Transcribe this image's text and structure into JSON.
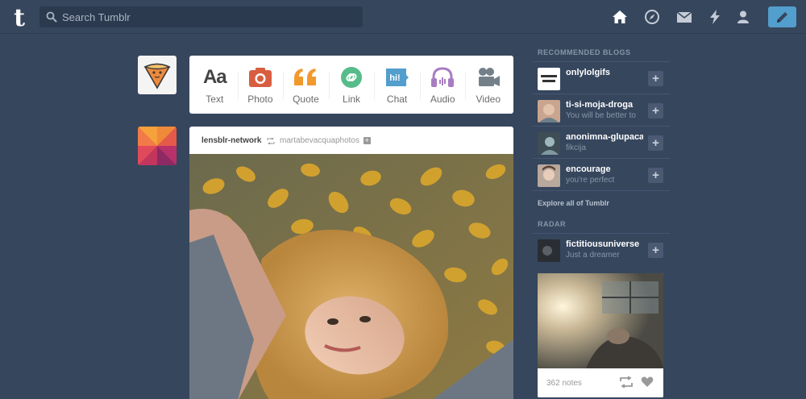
{
  "header": {
    "logo_letter": "t",
    "search_placeholder": "Search Tumblr",
    "nav_icons": [
      "home-icon",
      "explore-compass-icon",
      "inbox-mail-icon",
      "activity-lightning-icon",
      "account-person-icon",
      "compose-pencil-icon"
    ]
  },
  "post_types": [
    {
      "label": "Text",
      "icon": "text-icon",
      "color": "#444444"
    },
    {
      "label": "Photo",
      "icon": "camera-icon",
      "color": "#d95e40"
    },
    {
      "label": "Quote",
      "icon": "quote-icon",
      "color": "#f2992e"
    },
    {
      "label": "Link",
      "icon": "link-icon",
      "color": "#56bc8a"
    },
    {
      "label": "Chat",
      "icon": "chat-icon",
      "color": "#529ecc"
    },
    {
      "label": "Audio",
      "icon": "headphones-icon",
      "color": "#a77dc2"
    },
    {
      "label": "Video",
      "icon": "video-camera-icon",
      "color": "#748089"
    }
  ],
  "post": {
    "blog": "lensblr-network",
    "reblogged_from": "martabevacquaphotos"
  },
  "sidebar": {
    "recommended_heading": "Recommended Blogs",
    "recommended": [
      {
        "name": "onlylolgifs",
        "tagline": ""
      },
      {
        "name": "ti-si-moja-droga",
        "tagline": "You will be better to"
      },
      {
        "name": "anonimna-glupaca",
        "tagline": "fikcija"
      },
      {
        "name": "encourage",
        "tagline": "you're perfect"
      }
    ],
    "explore_link": "Explore all of Tumblr",
    "radar_heading": "Radar",
    "radar": {
      "name": "fictitiousuniverse",
      "tagline": "Just a dreamer",
      "notes": "362 notes"
    }
  },
  "colors": {
    "background": "#36465d",
    "accent": "#529ecc"
  }
}
